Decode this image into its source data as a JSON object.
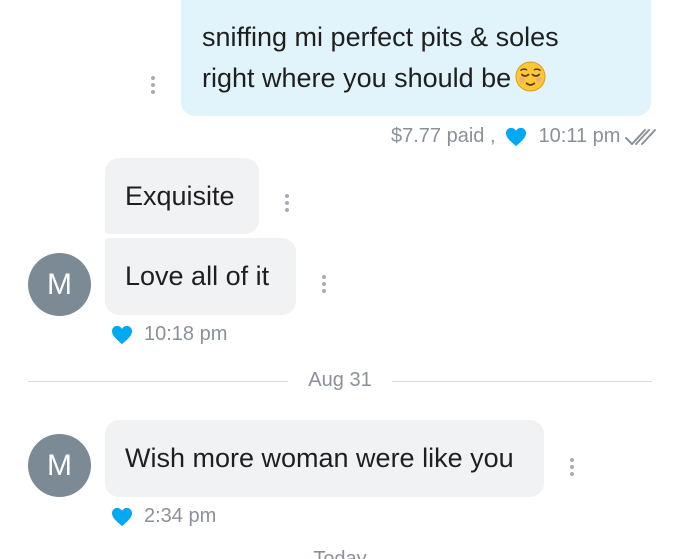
{
  "outgoing_message": {
    "line1": "sniffing mi perfect pits & soles",
    "line2": "right where you should be",
    "emoji": "relieved-face-emoji",
    "price": "$7.77 paid ,",
    "time": "10:11 pm",
    "status_icon": "double-check-icon"
  },
  "incoming_group_1": {
    "avatar_letter": "M",
    "messages": [
      "Exquisite",
      "Love all of it"
    ],
    "time": "10:18 pm"
  },
  "date_divider": "Aug 31",
  "incoming_group_2": {
    "avatar_letter": "M",
    "message": "Wish more woman were like you",
    "time": "2:34 pm"
  },
  "next_divider_partial": "Today",
  "colors": {
    "outgoing_bubble": "#e2f4fb",
    "incoming_bubble": "#f1f2f4",
    "heart": "#00a9f1",
    "avatar": "#7b8a95",
    "meta_text": "#8a9199"
  }
}
